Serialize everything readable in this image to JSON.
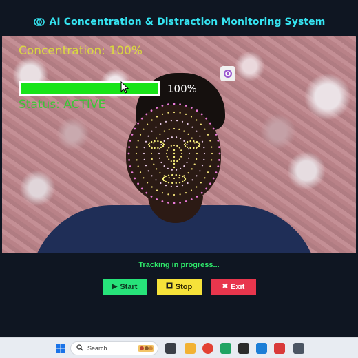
{
  "app": {
    "title": "AI Concentration & Distraction Monitoring System",
    "title_icon": "brain-icon"
  },
  "camera": {
    "concentration_label": "Concentration: 100%",
    "concentration_level": 1.0,
    "progress_percent_text": "100%",
    "status_label": "Status: ACTIVE"
  },
  "status_message": "Tracking in progress...",
  "controls": {
    "start": {
      "label": "Start",
      "icon": "play-icon"
    },
    "stop": {
      "label": "Stop",
      "icon": "stop-icon"
    },
    "exit": {
      "label": "Exit",
      "icon": "close-icon"
    }
  },
  "taskbar": {
    "search_placeholder": "Search"
  },
  "colors": {
    "title": "#35e3f0",
    "progress": "#18e418",
    "start": "#27e37a",
    "stop": "#f6e23a",
    "exit": "#e8364d"
  }
}
